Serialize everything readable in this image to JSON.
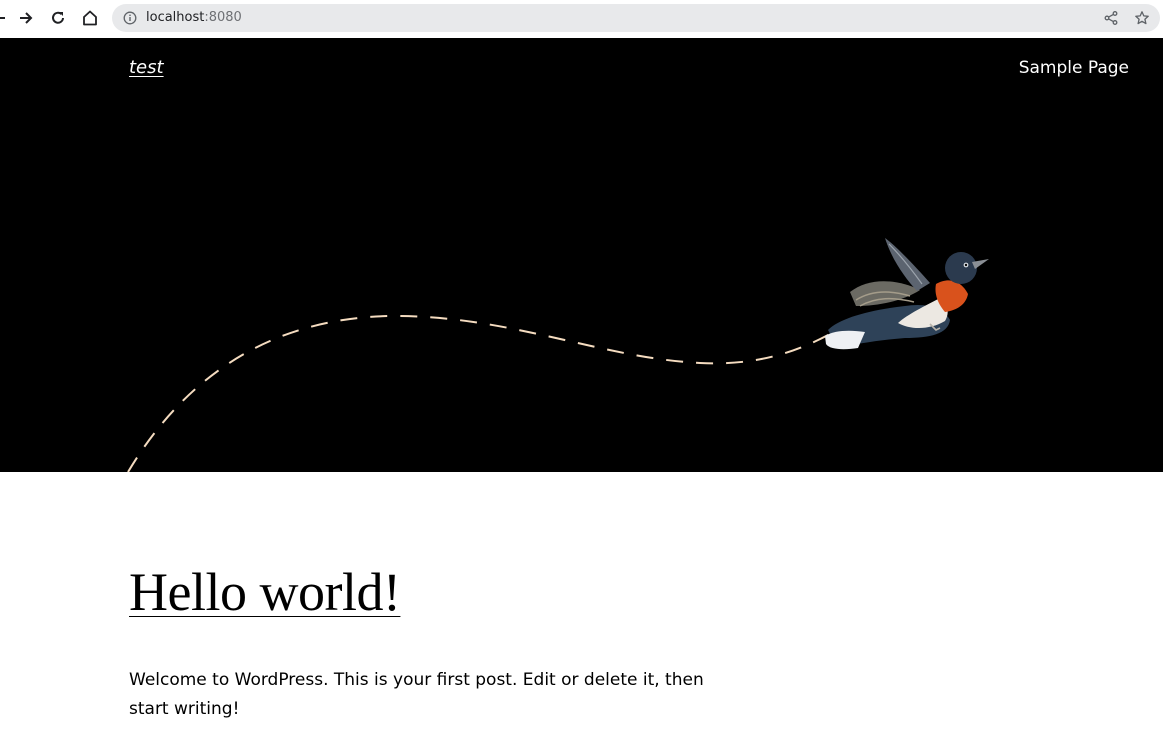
{
  "browser": {
    "url_host": "localhost",
    "url_port": ":8080",
    "icons": [
      "arrow-right-icon",
      "reload-icon",
      "home-icon",
      "info-icon",
      "share-icon",
      "star-icon"
    ]
  },
  "site": {
    "title": "test",
    "nav": [
      {
        "label": "Sample Page"
      }
    ]
  },
  "hero": {
    "background": "#000000",
    "flight_path_color": "#f5dcc0"
  },
  "post": {
    "title": "Hello world!",
    "excerpt": "Welcome to WordPress. This is your first post. Edit or delete it, then start writing!"
  }
}
